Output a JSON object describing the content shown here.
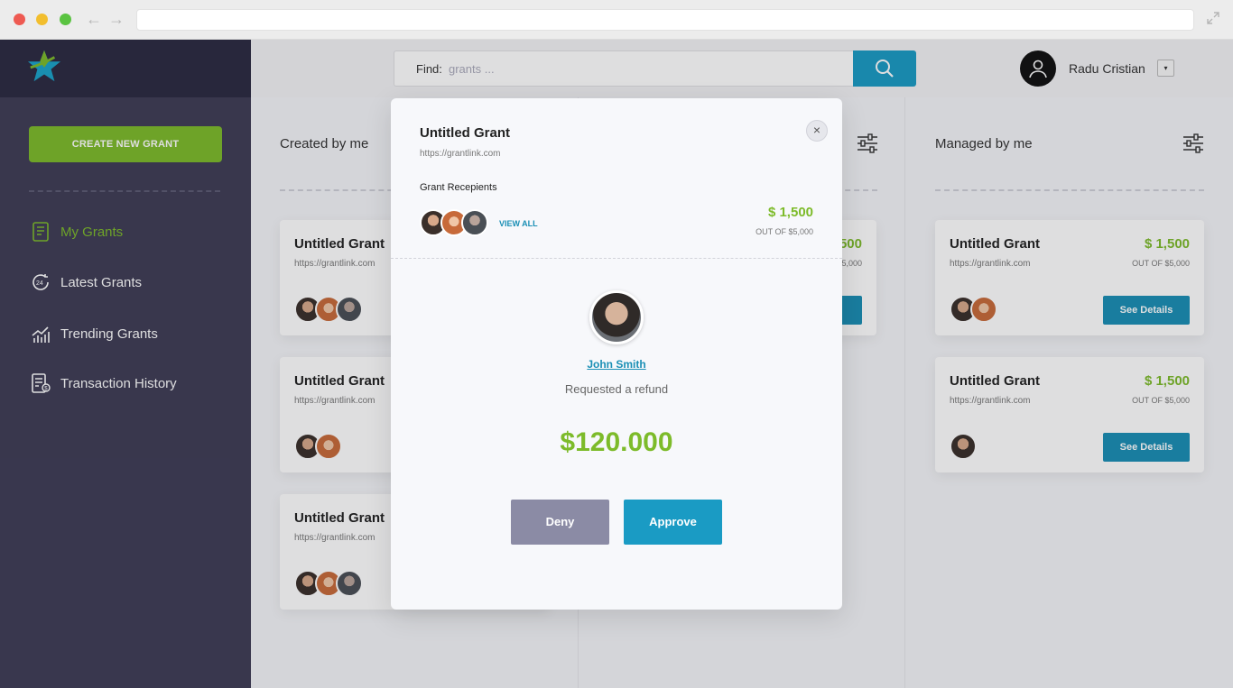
{
  "sidebar": {
    "create_button": "CREATE NEW GRANT",
    "items": [
      {
        "label": "My Grants",
        "icon": "receipt-icon",
        "active": true
      },
      {
        "label": "Latest Grants",
        "icon": "clock-24-icon",
        "active": false
      },
      {
        "label": "Trending Grants",
        "icon": "trending-chart-icon",
        "active": false
      },
      {
        "label": "Transaction History",
        "icon": "document-dollar-icon",
        "active": false
      }
    ]
  },
  "header": {
    "search_label": "Find:",
    "search_placeholder": "grants ...",
    "user_name": "Radu Cristian",
    "dropdown_glyph": "▾"
  },
  "columns": [
    {
      "title": "Created by me"
    },
    {
      "title": ""
    },
    {
      "title": "Managed by me"
    }
  ],
  "cards": [
    {
      "title": "Untitled Grant",
      "url": "https://grantlink.com",
      "amount": "$ 1,500",
      "out_of": "OUT OF $5,000",
      "button": "See Details"
    },
    {
      "title": "Untitled Grant",
      "url": "https://grantlink.com",
      "amount": "$ 1,500",
      "out_of": "OUT OF $5,000",
      "button": "See Details"
    },
    {
      "title": "Untitled Grant",
      "url": "https://grantlink.com",
      "amount": "$ 1,500",
      "out_of": "OUT OF $5,000",
      "button": "See Details"
    },
    {
      "title": "Untitled Grant",
      "url": "https://grantlink.com",
      "amount": "$ 1,500",
      "out_of": "OUT OF $5,000",
      "button": "See Details"
    },
    {
      "title": "Untitled Grant",
      "url": "https://grantlink.com",
      "amount": "$ 1,500",
      "out_of": "OUT OF $5,000",
      "button": "See Details"
    },
    {
      "title": "Untitled Grant",
      "url": "https://grantlink.com",
      "amount": "$ 1,500",
      "out_of": "OUT OF $5,000",
      "button": "See Details"
    }
  ],
  "partial_card": {
    "amount": "500",
    "out_of": "5,000",
    "button": "s"
  },
  "modal": {
    "title": "Untitled Grant",
    "url": "https://grantlink.com",
    "close_glyph": "×",
    "recipients_label": "Grant Recepients",
    "view_all": "VIEW ALL",
    "amount": "$ 1,500",
    "out_of": "OUT OF $5,000",
    "user_name": "John Smith",
    "request_text": "Requested a refund",
    "refund_amount": "$120.000",
    "deny": "Deny",
    "approve": "Approve"
  },
  "colors": {
    "accent_green": "#7dbb2a",
    "accent_blue": "#1a9bc4",
    "sidebar_bg": "#3f3d56",
    "deny_gray": "#8b8ba5"
  }
}
